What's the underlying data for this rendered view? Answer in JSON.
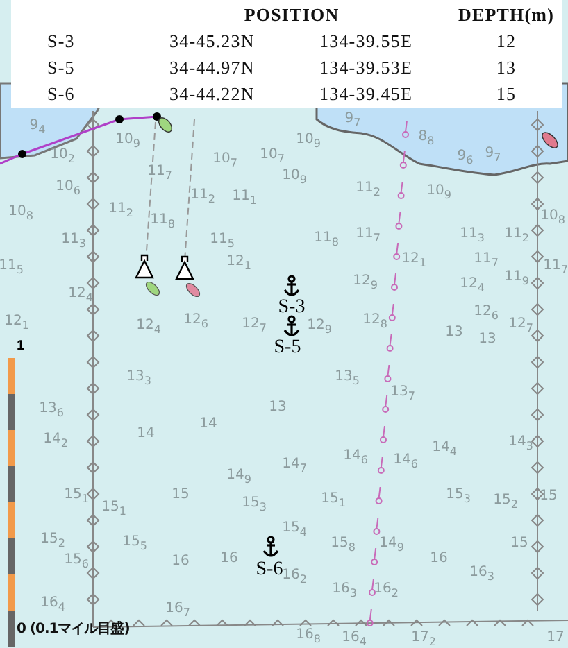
{
  "table": {
    "header": {
      "position": "POSITION",
      "depth": "DEPTH(m)"
    },
    "rows": [
      {
        "station": "S-3",
        "latitude": "34-45.23N",
        "longitude": "134-39.55E",
        "depth": "12"
      },
      {
        "station": "S-5",
        "latitude": "34-44.97N",
        "longitude": "134-39.53E",
        "depth": "13"
      },
      {
        "station": "S-6",
        "latitude": "34-44.22N",
        "longitude": "134-39.45E",
        "depth": "15"
      }
    ]
  },
  "map": {
    "soundings": [
      "9$_{4}$",
      "10$_{9}$",
      "10$_{2}$",
      "10$_{7}$",
      "10$_{7}$",
      "10$_{6}$",
      "11$_{7}$",
      "11$_{2}$",
      "11$_{1}$",
      "10$_{8}$",
      "11$_{2}$",
      "11$_{8}$",
      "11$_{3}$",
      "11$_{5}$",
      "11$_{5}$",
      "12$_{1}$",
      "12$_{1}$",
      "12$_{4}$",
      "12$_{6}$",
      "12$_{7}$",
      "12$_{4}$",
      "13$_{3}$",
      "10$_{9}$",
      "9$_{7}$",
      "8$_{8}$",
      "9$_{6}$",
      "9$_{7}$",
      "10$_{9}$",
      "11$_{2}$",
      "10$_{9}$",
      "10$_{8}$",
      "11$_{8}$",
      "11$_{7}$",
      "11$_{3}$",
      "11$_{2}$",
      "12$_{1}$",
      "11$_{7}$",
      "12$_{9}$",
      "12$_{4}$",
      "11$_{9}$",
      "11$_{7}$",
      "12$_{9}$",
      "12$_{8}$",
      "12$_{6}$",
      "13",
      "13",
      "12$_{7}$",
      "13$_{5}$",
      "13$_{6}$",
      "14$_{2}$",
      "14",
      "14",
      "14$_{9}$",
      "13",
      "15$_{1}$",
      "15$_{1}$",
      "15",
      "15$_{3}$",
      "15$_{2}$",
      "15$_{5}$",
      "15$_{6}$",
      "16",
      "16",
      "16$_{4}$",
      "16$_{7}$",
      "13$_{7}$",
      "14$_{7}$",
      "14$_{6}$",
      "14$_{6}$",
      "14$_{4}$",
      "14$_{3}$",
      "15$_{1}$",
      "15$_{3}$",
      "15$_{2}$",
      "15",
      "15$_{4}$",
      "15$_{8}$",
      "14$_{9}$",
      "16",
      "15",
      "16$_{2}$",
      "16$_{3}$",
      "16$_{2}$",
      "16$_{3}$",
      "16$_{8}$",
      "16$_{4}$",
      "17$_{2}$",
      "17"
    ],
    "stations": [
      {
        "label": "S-3"
      },
      {
        "label": "S-5"
      },
      {
        "label": "S-6"
      }
    ],
    "scale_bar": {
      "top_label": "1",
      "bottom_label": "0 (0.1マイル目盛)"
    }
  }
}
